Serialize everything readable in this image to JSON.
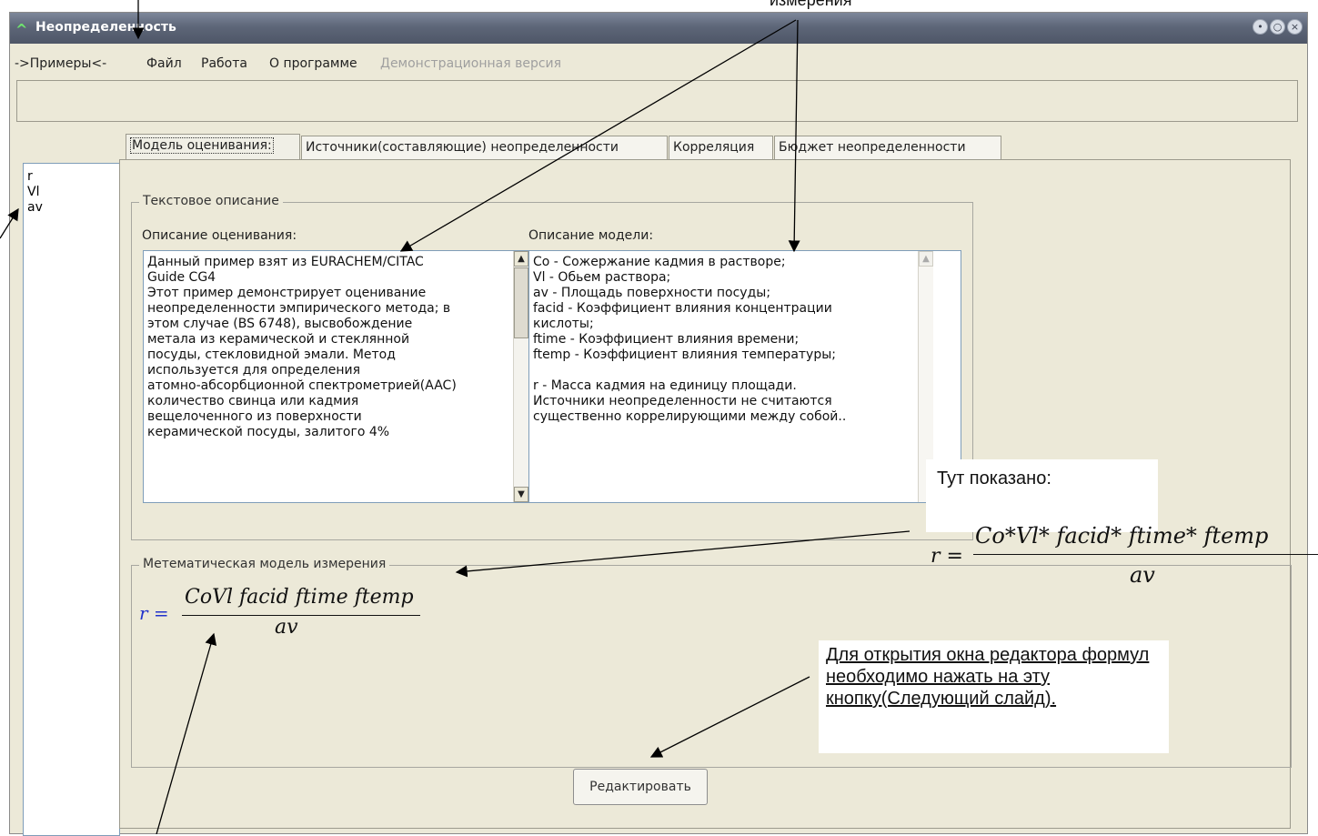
{
  "window": {
    "title": "Неопределенность",
    "controls": [
      "•",
      "○",
      "×"
    ]
  },
  "menu": {
    "examples": "->Примеры<-",
    "file": "Файл",
    "work": "Работа",
    "about": "О программе",
    "demo": "Демонстрационная версия"
  },
  "variables": [
    "r",
    "Vl",
    "av"
  ],
  "tabs": [
    "Модель оценивания:",
    "Источники(составляющие) неопределенности",
    "Корреляция",
    "Бюджет неопределенности"
  ],
  "text_group": {
    "legend": "Текстовое описание",
    "estimation_label": "Описание оценивания:",
    "estimation_lines": [
      "Данный пример взят из EURACHEM/CITAC",
      "Guide CG4",
      "Этот пример демонстрирует оценивание",
      "неопределенности эмпирического метода; в",
      "этом случае (BS 6748), высвобождение",
      "метала из керамической и стеклянной",
      "посуды, стекловидной эмали. Метод",
      "используется для определения",
      "атомно-абсорбционной спектрометрией(AAC)",
      "количество свинца или кадмия",
      "вещелоченного из поверхности",
      "керамической посуды, залитого 4%"
    ],
    "model_label": "Описание модели:",
    "model_lines": [
      "Co - Сожержание кадмия в растворе;",
      "Vl - Обьем раствора;",
      "av - Площадь поверхности посуды;",
      "facid - Коэффициент влияния концентрации",
      "кислоты;",
      "ftime - Коэффициент влияния времени;",
      "ftemp - Коэффициент влияния температуры;",
      "",
      "r - Масса кадмия на единицу площади.",
      "Источники неопределенности не считаются",
      "существенно коррелирующими между собой.."
    ]
  },
  "math_group": {
    "legend": "Метематическая модель измерения",
    "lhs": "r =",
    "numerator": "CoVl facid ftime ftemp",
    "denominator": "av"
  },
  "edit_button": "Редактировать",
  "annotations": {
    "top_label": "измерения",
    "shown_label": "Тут показано:",
    "shown_lhs": "r =",
    "shown_numerator": "Co*Vl* facid* ftime* ftemp",
    "shown_denominator": "av",
    "edit_note": "Для открытия окна редактора формул необходимо нажать на эту кнопку(Следующий слайд)."
  },
  "colors": {
    "window_bg": "#ece9d8",
    "titlebar": "#5d6678",
    "formula_lhs": "#2233cc"
  }
}
